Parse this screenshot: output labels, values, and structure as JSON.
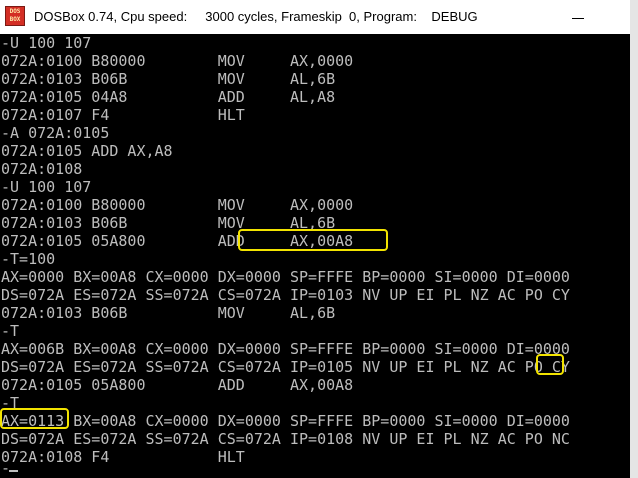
{
  "window": {
    "title": "DOSBox 0.74, Cpu speed:     3000 cycles, Frameskip  0, Program:    DEBUG",
    "icon": "dosbox-icon",
    "icon_text": "DOS BOX"
  },
  "console": {
    "lines": [
      "-U 100 107",
      "072A:0100 B80000        MOV     AX,0000",
      "072A:0103 B06B          MOV     AL,6B",
      "072A:0105 04A8          ADD     AL,A8",
      "072A:0107 F4            HLT",
      "-A 072A:0105",
      "072A:0105 ADD AX,A8",
      "072A:0108",
      "-U 100 107",
      "072A:0100 B80000        MOV     AX,0000",
      "072A:0103 B06B          MOV     AL,6B",
      "072A:0105 05A800        ADD     AX,00A8",
      "-T=100",
      "AX=0000 BX=00A8 CX=0000 DX=0000 SP=FFFE BP=0000 SI=0000 DI=0000",
      "DS=072A ES=072A SS=072A CS=072A IP=0103 NV UP EI PL NZ AC PO CY",
      "072A:0103 B06B          MOV     AL,6B",
      "-T",
      "AX=006B BX=00A8 CX=0000 DX=0000 SP=FFFE BP=0000 SI=0000 DI=0000",
      "DS=072A ES=072A SS=072A CS=072A IP=0105 NV UP EI PL NZ AC PO CY",
      "072A:0105 05A800        ADD     AX,00A8",
      "-T",
      "AX=0113 BX=00A8 CX=0000 DX=0000 SP=FFFE BP=0000 SI=0000 DI=0000",
      "DS=072A ES=072A SS=072A CS=072A IP=0108 NV UP EI PL NZ AC PO NC",
      "072A:0108 F4            HLT",
      "-"
    ]
  },
  "colors": {
    "console_bg": "#000000",
    "console_text": "#bdbdbd",
    "highlight": "#f2e300"
  }
}
